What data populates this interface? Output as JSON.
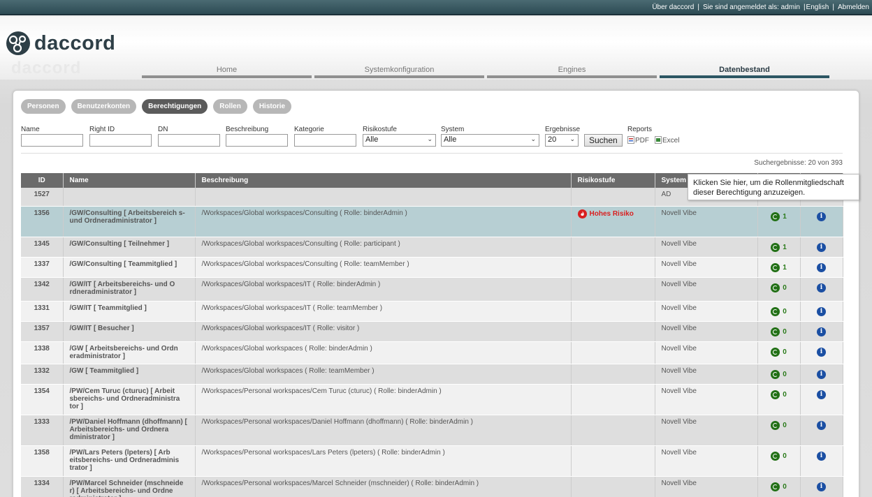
{
  "topbar": {
    "about": "Über daccord",
    "logged_in": "Sie sind angemeldet als: admin",
    "language": "English",
    "logout": "Abmelden"
  },
  "logo": {
    "text": "daccord"
  },
  "nav": {
    "tabs": [
      "Home",
      "Systemkonfiguration",
      "Engines",
      "Datenbestand"
    ],
    "active": "Datenbestand"
  },
  "subtabs": {
    "items": [
      "Personen",
      "Benutzerkonten",
      "Berechtigungen",
      "Rollen",
      "Historie"
    ],
    "active": "Berechtigungen"
  },
  "filters": {
    "name_label": "Name",
    "rightid_label": "Right ID",
    "dn_label": "DN",
    "beschreibung_label": "Beschreibung",
    "kategorie_label": "Kategorie",
    "risikostufe_label": "Risikostufe",
    "risikostufe_value": "Alle",
    "system_label": "System",
    "system_value": "Alle",
    "ergebnisse_label": "Ergebnisse",
    "ergebnisse_value": "20",
    "search_button": "Suchen",
    "reports_label": "Reports",
    "pdf": "PDF",
    "excel": "Excel"
  },
  "results": {
    "text": "Suchergebnisse: 20 von 393"
  },
  "table": {
    "headers": {
      "id": "ID",
      "name": "Name",
      "beschreibung": "Beschreibung",
      "risikostufe": "Risikostufe",
      "system": "System"
    },
    "rows": [
      {
        "id": "1527",
        "name": "",
        "desc": "",
        "risk": "",
        "system": "AD",
        "roles": "",
        "selected": false
      },
      {
        "id": "1356",
        "name": "/GW/Consulting [ Arbeitsbereich s- und Ordneradministrator ]",
        "desc": "/Workspaces/Global workspaces/Consulting ( Rolle: binderAdmin )",
        "risk": "Hohes Risiko",
        "system": "Novell Vibe",
        "roles": "1",
        "selected": true
      },
      {
        "id": "1345",
        "name": "/GW/Consulting [ Teilnehmer ]",
        "desc": "/Workspaces/Global workspaces/Consulting ( Rolle: participant )",
        "risk": "",
        "system": "Novell Vibe",
        "roles": "1",
        "selected": false
      },
      {
        "id": "1337",
        "name": "/GW/Consulting [ Teammitglied ]",
        "desc": "/Workspaces/Global workspaces/Consulting ( Rolle: teamMember )",
        "risk": "",
        "system": "Novell Vibe",
        "roles": "1",
        "selected": false
      },
      {
        "id": "1342",
        "name": "/GW/IT [ Arbeitsbereichs- und O rdneradministrator ]",
        "desc": "/Workspaces/Global workspaces/IT ( Rolle: binderAdmin )",
        "risk": "",
        "system": "Novell Vibe",
        "roles": "0",
        "selected": false
      },
      {
        "id": "1331",
        "name": "/GW/IT [ Teammitglied ]",
        "desc": "/Workspaces/Global workspaces/IT ( Rolle: teamMember )",
        "risk": "",
        "system": "Novell Vibe",
        "roles": "0",
        "selected": false
      },
      {
        "id": "1357",
        "name": "/GW/IT [ Besucher ]",
        "desc": "/Workspaces/Global workspaces/IT ( Rolle: visitor )",
        "risk": "",
        "system": "Novell Vibe",
        "roles": "0",
        "selected": false
      },
      {
        "id": "1338",
        "name": "/GW [ Arbeitsbereichs- und Ordn eradministrator ]",
        "desc": "/Workspaces/Global workspaces ( Rolle: binderAdmin )",
        "risk": "",
        "system": "Novell Vibe",
        "roles": "0",
        "selected": false
      },
      {
        "id": "1332",
        "name": "/GW [ Teammitglied ]",
        "desc": "/Workspaces/Global workspaces ( Rolle: teamMember )",
        "risk": "",
        "system": "Novell Vibe",
        "roles": "0",
        "selected": false
      },
      {
        "id": "1354",
        "name": "/PW/Cem Turuc (cturuc) [ Arbeit sbereichs- und Ordneradministra tor ]",
        "desc": "/Workspaces/Personal workspaces/Cem Turuc (cturuc) ( Rolle: binderAdmin )",
        "risk": "",
        "system": "Novell Vibe",
        "roles": "0",
        "selected": false
      },
      {
        "id": "1333",
        "name": "/PW/Daniel Hoffmann (dhoffmann) [ Arbeitsbereichs- und Ordnera dministrator ]",
        "desc": "/Workspaces/Personal workspaces/Daniel Hoffmann (dhoffmann) ( Rolle: binderAdmin )",
        "risk": "",
        "system": "Novell Vibe",
        "roles": "0",
        "selected": false
      },
      {
        "id": "1358",
        "name": "/PW/Lars Peters (lpeters) [ Arb eitsbereichs- und Ordneradminis trator ]",
        "desc": "/Workspaces/Personal workspaces/Lars Peters (lpeters) ( Rolle: binderAdmin )",
        "risk": "",
        "system": "Novell Vibe",
        "roles": "0",
        "selected": false
      },
      {
        "id": "1334",
        "name": "/PW/Marcel Schneider (mschneide r) [ Arbeitsbereichs- und Ordne radministrator ]",
        "desc": "/Workspaces/Personal workspaces/Marcel Schneider (mschneider) ( Rolle: binderAdmin )",
        "risk": "",
        "system": "Novell Vibe",
        "roles": "0",
        "selected": false
      }
    ]
  },
  "tooltip": {
    "text": "Klicken Sie hier, um die Rollenmitgliedschaft dieser Berechtigung anzuzeigen."
  },
  "colors": {
    "topbar": "#2d4b54",
    "selected_row": "#b7cfd3",
    "risk_high": "#d92020",
    "role_icon": "#227016",
    "info_icon": "#1b4fa3"
  }
}
